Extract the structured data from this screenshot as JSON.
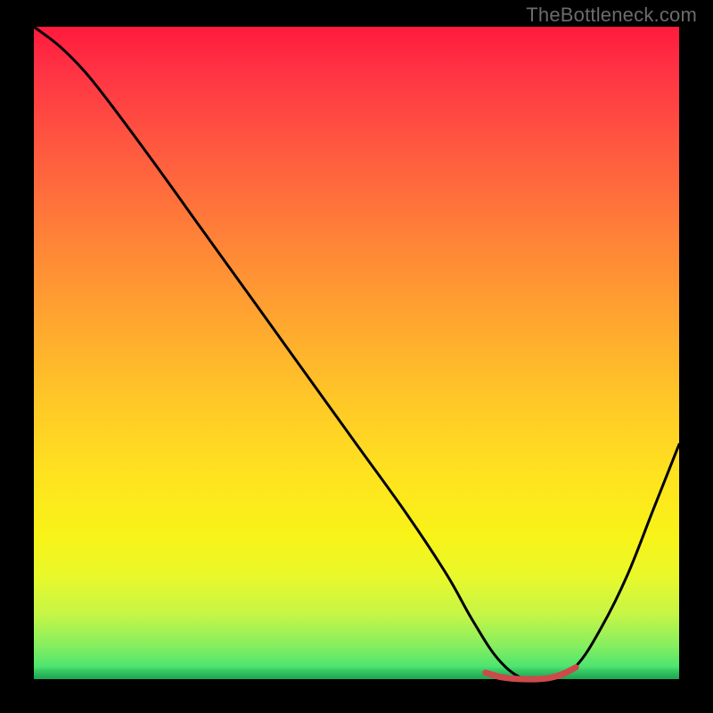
{
  "watermark": "TheBottleneck.com",
  "colors": {
    "background": "#000000",
    "curve_main": "#000000",
    "curve_marker": "#cc4a4a",
    "gradient_top": "#ff1a3c",
    "gradient_bottom": "#2bde78"
  },
  "chart_data": {
    "type": "line",
    "title": "",
    "subtitle": "",
    "xlabel": "",
    "ylabel": "",
    "xlim": [
      0,
      100
    ],
    "ylim": [
      0,
      100
    ],
    "grid": false,
    "legend": false,
    "annotations": [],
    "series": [
      {
        "name": "bottleneck-curve",
        "color": "#000000",
        "x": [
          0,
          4,
          8,
          12,
          18,
          26,
          34,
          42,
          50,
          58,
          64,
          68,
          72,
          76,
          80,
          84,
          88,
          92,
          96,
          100
        ],
        "y": [
          100,
          97,
          93,
          88,
          80,
          69,
          58,
          47,
          36,
          25,
          16,
          9,
          3,
          0,
          0,
          2,
          8,
          16,
          26,
          36
        ]
      },
      {
        "name": "optimal-range-marker",
        "color": "#cc4a4a",
        "x": [
          70,
          72,
          74,
          76,
          78,
          80,
          82,
          84
        ],
        "y": [
          1,
          0.4,
          0.1,
          0,
          0,
          0.2,
          0.8,
          1.8
        ]
      }
    ]
  }
}
